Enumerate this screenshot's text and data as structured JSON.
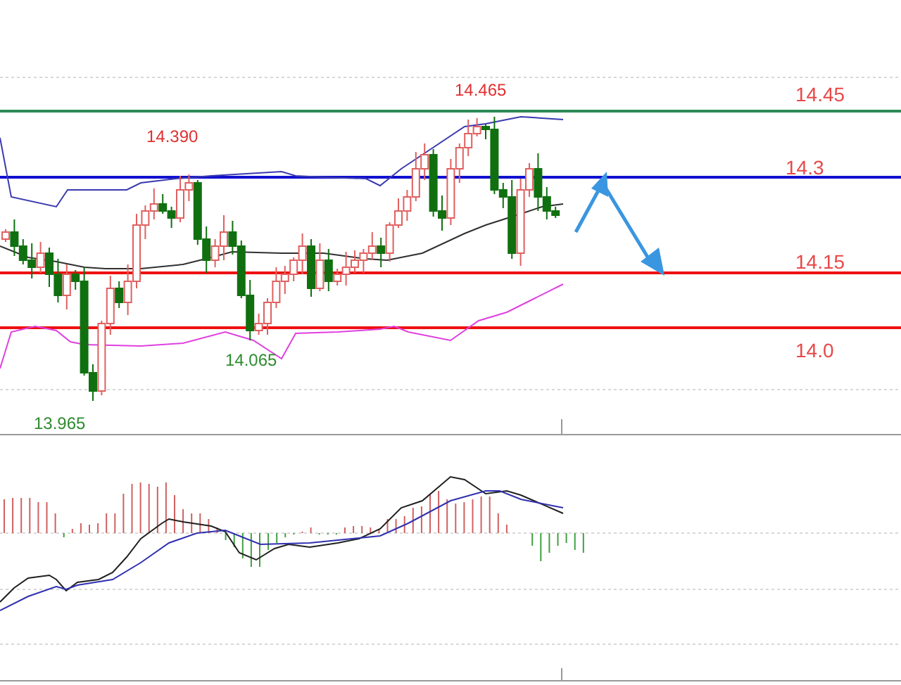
{
  "price_chart": {
    "level_lines": [
      {
        "label": "14.45",
        "color": "#2e8b57"
      },
      {
        "label": "14.3",
        "color": "#1010d0"
      },
      {
        "label": "14.15",
        "color": "#ee1111"
      },
      {
        "label": "14.0",
        "color": "#ee1111"
      }
    ],
    "price_labels": [
      {
        "text": "14.465",
        "kind": "high"
      },
      {
        "text": "14.390",
        "kind": "high"
      },
      {
        "text": "14.065",
        "kind": "low"
      },
      {
        "text": "13.965",
        "kind": "low"
      }
    ]
  }
}
